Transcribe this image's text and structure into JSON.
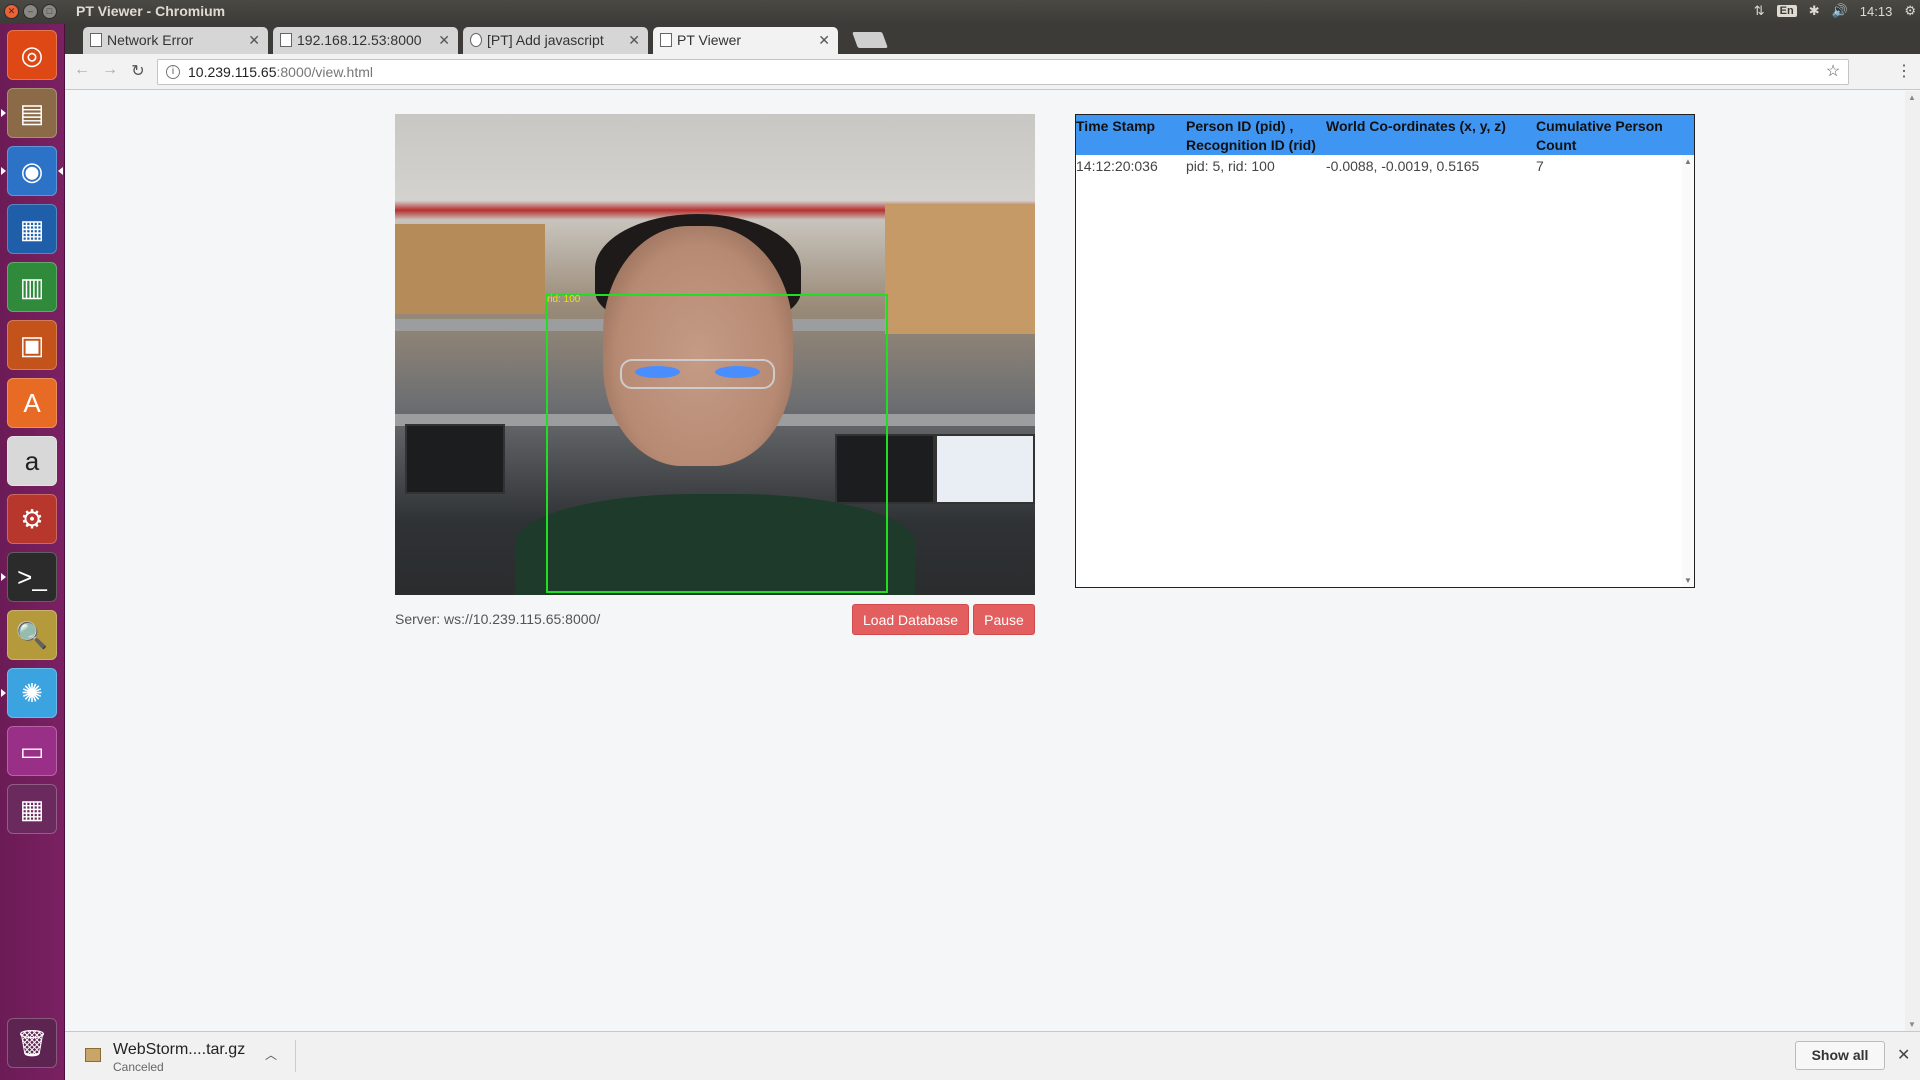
{
  "window": {
    "title": "PT Viewer - Chromium"
  },
  "panel": {
    "input_method": "En",
    "clock": "14:13"
  },
  "tabs": [
    {
      "label": "Network Error"
    },
    {
      "label": "192.168.12.53:8000"
    },
    {
      "label": "[PT] Add javascript"
    },
    {
      "label": "PT Viewer"
    }
  ],
  "address": {
    "host": "10.239.115.65",
    "path": ":8000/view.html"
  },
  "camera": {
    "overlay_label": "rid: 100"
  },
  "server": {
    "label": "Server: ws://10.239.115.65:8000/"
  },
  "buttons": {
    "load_database": "Load Database",
    "pause": "Pause"
  },
  "table": {
    "headers": {
      "timestamp": "Time Stamp",
      "person_id_1": "Person ID (pid) ,",
      "person_id_2": "Recognition ID (rid)",
      "world": "World Co-ordinates (x, y, z)",
      "count_1": "Cumulative Person",
      "count_2": "Count"
    },
    "rows": [
      {
        "timestamp": "14:12:20:036",
        "ids": "pid: 5, rid: 100",
        "world": "-0.0088, -0.0019, 0.5165",
        "count": "7"
      }
    ]
  },
  "download": {
    "filename": "WebStorm....tar.gz",
    "status": "Canceled",
    "show_all": "Show all"
  },
  "colors": {
    "header_bg": "#3f95f2",
    "button_bg": "#e35e5e",
    "face_box": "#22dd22",
    "launcher": "#7a2163"
  }
}
